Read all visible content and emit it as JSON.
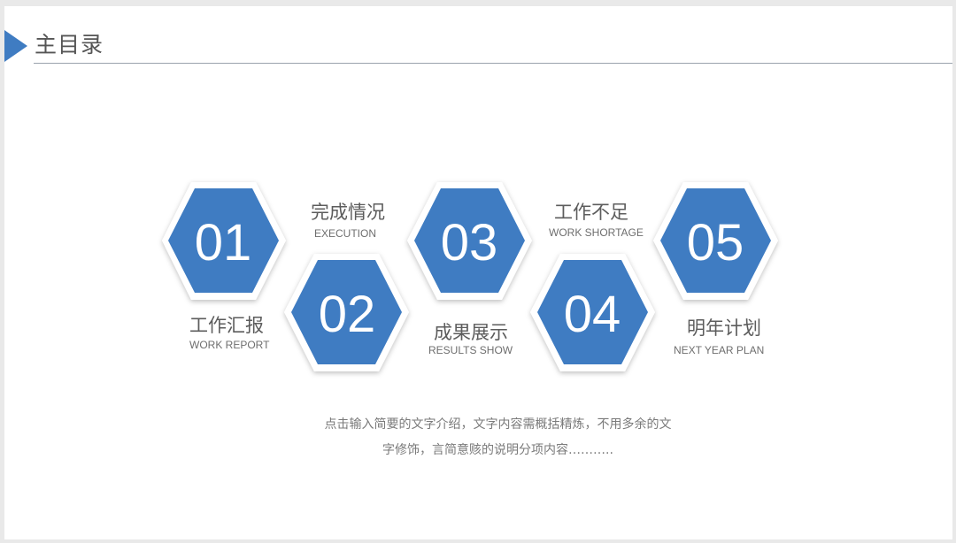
{
  "slide": {
    "title": "主目录",
    "accent_color": "#3f7cc2"
  },
  "hexagons": [
    {
      "number": "01"
    },
    {
      "number": "02"
    },
    {
      "number": "03"
    },
    {
      "number": "04"
    },
    {
      "number": "05"
    }
  ],
  "sections": [
    {
      "title": "工作汇报",
      "subtitle": "WORK REPORT"
    },
    {
      "title": "完成情况",
      "subtitle": "EXECUTION"
    },
    {
      "title": "成果展示",
      "subtitle": "RESULTS SHOW"
    },
    {
      "title": "工作不足",
      "subtitle": "WORK SHORTAGE"
    },
    {
      "title": "明年计划",
      "subtitle": "NEXT YEAR PLAN"
    }
  ],
  "description": {
    "line1": "点击输入简要的文字介绍，文字内容需概括精炼，不用多余的文",
    "line2": "字修饰，言简意赅的说明分项内容……….."
  }
}
